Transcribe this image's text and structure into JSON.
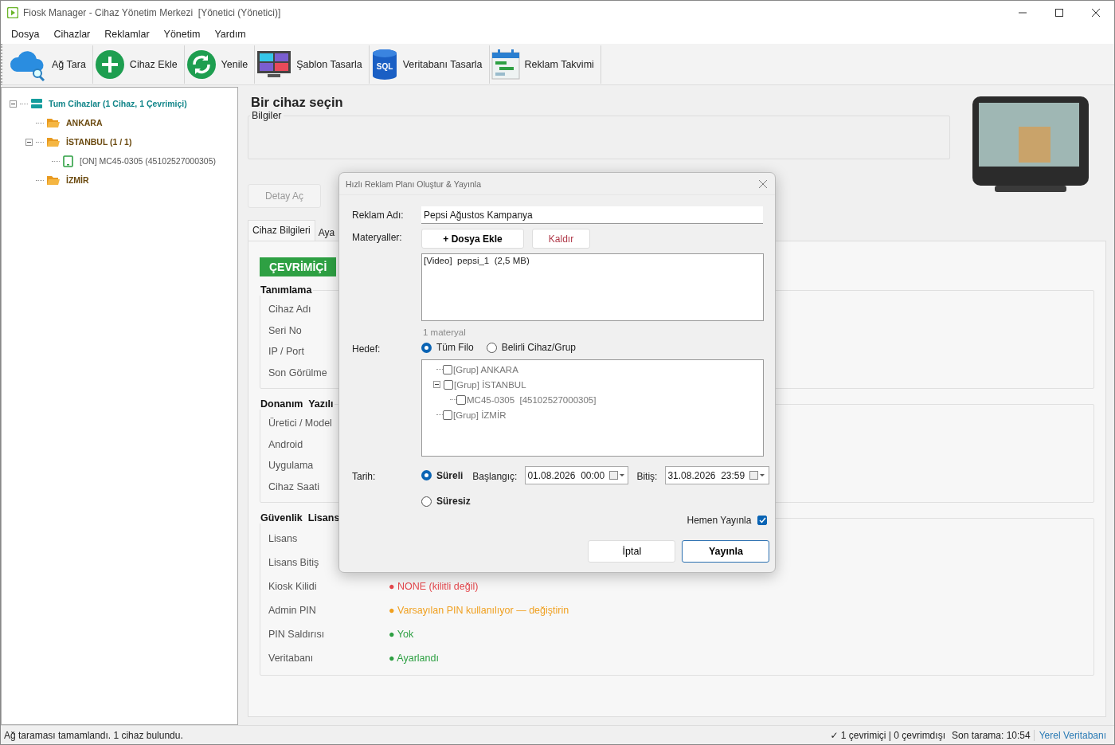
{
  "window": {
    "title": "Fiosk Manager - Cihaz Yönetim Merkezi  [Yönetici (Yönetici)]"
  },
  "menu": [
    "Dosya",
    "Cihazlar",
    "Reklamlar",
    "Yönetim",
    "Yardım"
  ],
  "toolbar": [
    {
      "label": "Ağ Tara",
      "kind": "scan"
    },
    {
      "label": "Cihaz Ekle",
      "kind": "add"
    },
    {
      "label": "Yenile",
      "kind": "refresh"
    },
    {
      "label": "Şablon Tasarla",
      "kind": "template"
    },
    {
      "label": "Veritabanı Tasarla",
      "kind": "database",
      "icon_text": "SQL"
    },
    {
      "label": "Reklam Takvimi",
      "kind": "calendar"
    }
  ],
  "device_tree": {
    "label": "Tum Cihazlar (1 Cihaz, 1 Çevrimiçi)",
    "kind": "root",
    "expanded": true,
    "children": [
      {
        "label": "ANKARA",
        "kind": "group"
      },
      {
        "label": "İSTANBUL (1 / 1)",
        "kind": "group",
        "expanded": true,
        "children": [
          {
            "label": "[ON] MC45-0305 (45102527000305)",
            "kind": "device"
          }
        ]
      },
      {
        "label": "İZMİR",
        "kind": "group"
      }
    ]
  },
  "details": {
    "title": "Bir cihaz seçin",
    "info_group": "Bilgiler",
    "buttons": [
      "Detay Aç"
    ],
    "tabs": [
      {
        "label": "Cihaz Bilgileri",
        "selected": true
      },
      {
        "label": "Aya",
        "selected": false
      }
    ],
    "status_badge": "ÇEVRİMİÇİ",
    "sections": [
      {
        "title": "Tanımlama",
        "rows": [
          {
            "label": "Cihaz Adı"
          },
          {
            "label": "Seri No"
          },
          {
            "label": "IP / Port"
          },
          {
            "label": "Son Görülme"
          }
        ]
      },
      {
        "title": "Donanım  Yazılı",
        "rows": [
          {
            "label": "Üretici / Model"
          },
          {
            "label": "Android"
          },
          {
            "label": "Uygulama"
          },
          {
            "label": "Cihaz Saati"
          }
        ]
      },
      {
        "title": "Güvenlik  Lisans",
        "rows": [
          {
            "label": "Lisans"
          },
          {
            "label": "Lisans Bitiş"
          },
          {
            "label": "Kiosk Kilidi",
            "value": "● NONE (kilitli değil)",
            "color": "#e5484d"
          },
          {
            "label": "Admin PIN",
            "value": "● Varsayılan PIN kullanılıyor — değiştirin",
            "color": "#f0a020"
          },
          {
            "label": "PIN Saldırısı",
            "value": "● Yok",
            "color": "#2ea043"
          },
          {
            "label": "Veritabanı",
            "value": "● Ayarlandı",
            "color": "#2ea043"
          }
        ]
      }
    ]
  },
  "dialog": {
    "title": "Hızlı Reklam Planı Oluştur & Yayınla",
    "name_label": "Reklam Adı:",
    "name_value": "Pepsi Ağustos Kampanya",
    "materials_label": "Materyaller:",
    "add_button": "+ Dosya Ekle",
    "remove_button": "Kaldır",
    "materials": [
      "[Video]  pepsi_1  (2,5 MB)"
    ],
    "materials_count": "1 materyal",
    "target_label": "Hedef:",
    "target_options": [
      {
        "label": "Tüm Filo",
        "selected": true
      },
      {
        "label": "Belirli Cihaz/Grup",
        "selected": false
      }
    ],
    "target_tree": [
      {
        "label": "[Grup] ANKARA",
        "checked": false
      },
      {
        "label": "[Grup] İSTANBUL",
        "checked": false,
        "expanded": true,
        "children": [
          {
            "label": "MC45-0305  [45102527000305]",
            "checked": false
          }
        ]
      },
      {
        "label": "[Grup] İZMİR",
        "checked": false
      }
    ],
    "date_label": "Tarih:",
    "date_options": [
      {
        "label": "Süreli",
        "selected": true
      },
      {
        "label": "Süresiz",
        "selected": false
      }
    ],
    "start_label": "Başlangıç:",
    "start_value": "01.08.2026  00:00",
    "end_label": "Bitiş:",
    "end_value": "31.08.2026  23:59",
    "publish_now": {
      "label": "Hemen Yayınla",
      "checked": true
    },
    "buttons": [
      {
        "label": "İptal",
        "kind": "cancel"
      },
      {
        "label": "Yayınla",
        "kind": "primary"
      }
    ]
  },
  "status_bar": {
    "message": "Ağ taraması tamamlandı. 1 cihaz bulundu.",
    "counts": "✓ 1 çevrimiçi | 0 çevrimdışı",
    "last_scan": "Son tarama: 10:54",
    "database": "Yerel Veritabanı"
  }
}
